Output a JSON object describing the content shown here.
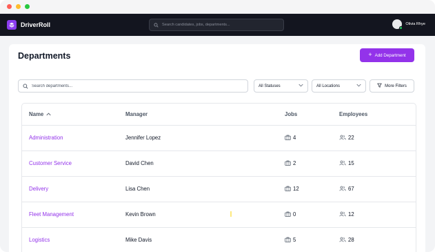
{
  "app": {
    "name": "DriverRoll"
  },
  "search": {
    "placeholder": "Search candidates, jobs, departments..."
  },
  "user": {
    "name": "Olivia Rhye"
  },
  "page": {
    "title": "Departments",
    "add_label": "Add Department"
  },
  "filters": {
    "search_placeholder": "Search departments...",
    "status": "All Statuses",
    "location": "All Locations",
    "more": "More Filters"
  },
  "table": {
    "columns": {
      "name": "Name",
      "manager": "Manager",
      "jobs": "Jobs",
      "employees": "Employees"
    },
    "rows": [
      {
        "name": "Administration",
        "manager": "Jennifer Lopez",
        "jobs": "4",
        "employees": "22"
      },
      {
        "name": "Customer Service",
        "manager": "David Chen",
        "jobs": "2",
        "employees": "15"
      },
      {
        "name": "Delivery",
        "manager": "Lisa Chen",
        "jobs": "12",
        "employees": "67"
      },
      {
        "name": "Fleet Management",
        "manager": "Kevin Brown",
        "jobs": "0",
        "employees": "12"
      },
      {
        "name": "Logistics",
        "manager": "Mike Davis",
        "jobs": "5",
        "employees": "28"
      }
    ]
  },
  "colors": {
    "accent": "#9333ea",
    "topbar": "#13151f",
    "online": "#22c55e"
  },
  "icons": [
    "layers-icon",
    "search-icon",
    "plus-icon",
    "chevron-down-icon",
    "filter-icon",
    "sort-up-icon",
    "briefcase-icon",
    "users-icon"
  ]
}
